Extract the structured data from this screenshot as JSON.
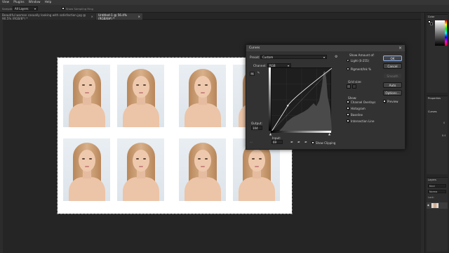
{
  "menubar": {
    "items": [
      "View",
      "Plugins",
      "Window",
      "Help"
    ]
  },
  "options_bar": {
    "sample_label": "Sample:",
    "sample_value": "All Layers",
    "show_ring_label": "Show Sampling Ring"
  },
  "tabs": [
    {
      "label": "Beautiful woman casually looking with satisfaction.jpg @ 90.5% (RGB/8*) *",
      "close": "×"
    },
    {
      "label": "Untitled-1 @ 56.4% (RGB/8#) *",
      "close": "×"
    }
  ],
  "curves": {
    "title": "Curves",
    "preset_label": "Preset:",
    "preset_value": "Custom",
    "channel_label": "Channel:",
    "channel_value": "RGB",
    "output_label": "Output:",
    "output_value": "104",
    "input_label": "Input:",
    "input_value": "69",
    "show_clipping": "Show Clipping",
    "show_amount_label": "Show Amount of:",
    "light_option": "Light  (0-255)",
    "pigment_option": "Pigment/Ink %",
    "grid_size_label": "Grid size:",
    "show_label": "Show:",
    "show_options": [
      {
        "label": "Channel Overlays",
        "checked": true
      },
      {
        "label": "Histogram",
        "checked": true
      },
      {
        "label": "Baseline",
        "checked": true
      },
      {
        "label": "Intersection Line",
        "checked": true
      }
    ],
    "buttons": {
      "ok": "OK",
      "cancel": "Cancel",
      "smooth": "Smooth",
      "auto": "Auto",
      "options": "Options..."
    },
    "preview_label": "Preview",
    "curve_points": [
      [
        0,
        0
      ],
      [
        69,
        104
      ],
      [
        255,
        255
      ]
    ]
  },
  "right_panels": {
    "color_tab": "Color",
    "properties_tab": "Properties",
    "curves_label": "Curves",
    "layers_tab": "Layers",
    "kind_label": "Kind",
    "normal_label": "Norma",
    "lock_label": "Lock:",
    "stat1": "0",
    "stat2": "8.4"
  },
  "colors": {
    "dialog": "#323232",
    "accent": "#8ab7ff",
    "canvas": "#252525"
  }
}
